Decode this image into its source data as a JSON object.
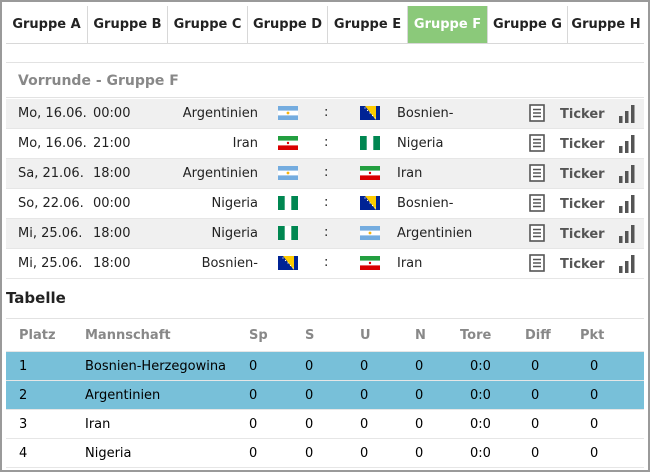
{
  "tabs": [
    {
      "label": "Gruppe A",
      "active": false
    },
    {
      "label": "Gruppe B",
      "active": false
    },
    {
      "label": "Gruppe C",
      "active": false
    },
    {
      "label": "Gruppe D",
      "active": false
    },
    {
      "label": "Gruppe E",
      "active": false
    },
    {
      "label": "Gruppe F",
      "active": true
    },
    {
      "label": "Gruppe G",
      "active": false
    },
    {
      "label": "Gruppe H",
      "active": false
    }
  ],
  "section_title": "Vorrunde - Gruppe F",
  "matches": [
    {
      "date": "Mo, 16.06.",
      "time": "00:00",
      "home": "Argentinien",
      "home_flag": "argentina-flag",
      "sep": ":",
      "away": "Bosnien-",
      "away_flag": "bosnia-flag",
      "ticker": "Ticker"
    },
    {
      "date": "Mo, 16.06.",
      "time": "21:00",
      "home": "Iran",
      "home_flag": "iran-flag",
      "sep": ":",
      "away": "Nigeria",
      "away_flag": "nigeria-flag",
      "ticker": "Ticker"
    },
    {
      "date": "Sa, 21.06.",
      "time": "18:00",
      "home": "Argentinien",
      "home_flag": "argentina-flag",
      "sep": ":",
      "away": "Iran",
      "away_flag": "iran-flag",
      "ticker": "Ticker"
    },
    {
      "date": "So, 22.06.",
      "time": "00:00",
      "home": "Nigeria",
      "home_flag": "nigeria-flag",
      "sep": ":",
      "away": "Bosnien-",
      "away_flag": "bosnia-flag",
      "ticker": "Ticker"
    },
    {
      "date": "Mi, 25.06.",
      "time": "18:00",
      "home": "Nigeria",
      "home_flag": "nigeria-flag",
      "sep": ":",
      "away": "Argentinien",
      "away_flag": "argentina-flag",
      "ticker": "Ticker"
    },
    {
      "date": "Mi, 25.06.",
      "time": "18:00",
      "home": "Bosnien-",
      "home_flag": "bosnia-flag",
      "sep": ":",
      "away": "Iran",
      "away_flag": "iran-flag",
      "ticker": "Ticker"
    }
  ],
  "table_title": "Tabelle",
  "table_headers": {
    "platz": "Platz",
    "mannschaft": "Mannschaft",
    "sp": "Sp",
    "s": "S",
    "u": "U",
    "n": "N",
    "tore": "Tore",
    "diff": "Diff",
    "pkt": "Pkt"
  },
  "table_rows": [
    {
      "platz": "1",
      "team": "Bosnien-Herzegowina",
      "sp": "0",
      "s": "0",
      "u": "0",
      "n": "0",
      "tore": "0:0",
      "diff": "0",
      "pkt": "0",
      "highlight": true
    },
    {
      "platz": "2",
      "team": "Argentinien",
      "sp": "0",
      "s": "0",
      "u": "0",
      "n": "0",
      "tore": "0:0",
      "diff": "0",
      "pkt": "0",
      "highlight": true
    },
    {
      "platz": "3",
      "team": "Iran",
      "sp": "0",
      "s": "0",
      "u": "0",
      "n": "0",
      "tore": "0:0",
      "diff": "0",
      "pkt": "0",
      "highlight": false
    },
    {
      "platz": "4",
      "team": "Nigeria",
      "sp": "0",
      "s": "0",
      "u": "0",
      "n": "0",
      "tore": "0:0",
      "diff": "0",
      "pkt": "0",
      "highlight": false
    }
  ],
  "colors": {
    "active_tab": "#8bc97a",
    "highlight_row": "#78c0d9"
  }
}
